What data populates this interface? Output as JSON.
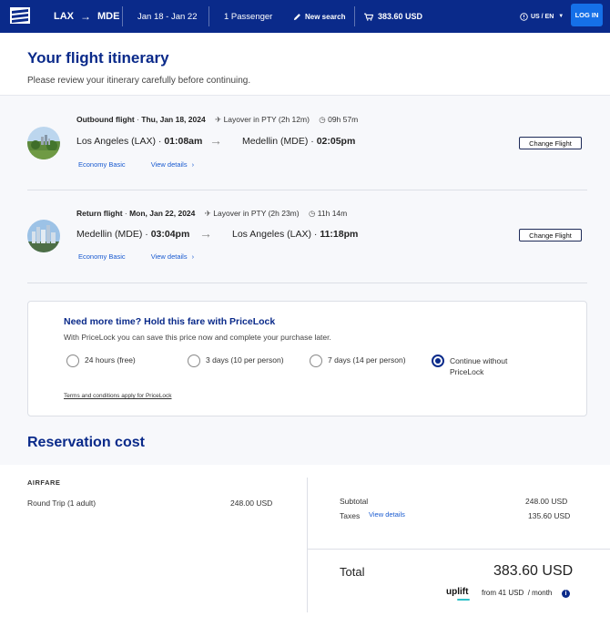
{
  "header": {
    "origin": "LAX",
    "destination": "MDE",
    "dates": "Jan 18 - Jan 22",
    "passengers": "1 Passenger",
    "new_search": "New search",
    "price": "383.60 USD",
    "language": "US / EN",
    "login": "LOG IN"
  },
  "hero": {
    "title": "Your flight itinerary",
    "subtitle": "Please review your itinerary carefully before continuing."
  },
  "outbound": {
    "label": "Outbound flight",
    "date": "Thu, Jan 18, 2024",
    "layover": "Layover in PTY (2h 12m)",
    "duration": "09h 57m",
    "from_city": "Los Angeles (LAX)",
    "from_time": "01:08am",
    "to_city": "Medellin (MDE)",
    "to_time": "02:05pm",
    "fare": "Economy Basic",
    "details": "View details",
    "change": "Change Flight"
  },
  "return": {
    "label": "Return flight",
    "date": "Mon, Jan 22, 2024",
    "layover": "Layover in PTY (2h 23m)",
    "duration": "11h 14m",
    "from_city": "Medellin (MDE)",
    "from_time": "03:04pm",
    "to_city": "Los Angeles (LAX)",
    "to_time": "11:18pm",
    "fare": "Economy Basic",
    "details": "View details",
    "change": "Change Flight"
  },
  "pricelock": {
    "title": "Need more time? Hold this fare with PriceLock",
    "subtitle": "With PriceLock you can save this price now and complete your purchase later.",
    "options": [
      {
        "label": "24 hours (free)",
        "selected": false
      },
      {
        "label": "3 days (10 per person)",
        "selected": false
      },
      {
        "label": "7 days (14 per person)",
        "selected": false
      },
      {
        "label_line1": "Continue without",
        "label_line2": "PriceLock",
        "selected": true
      }
    ],
    "terms": "Terms and conditions apply for PriceLock"
  },
  "reservation": {
    "title": "Reservation cost",
    "airfare_heading": "AIRFARE",
    "trip_label": "Round Trip (1 adult)",
    "trip_price": "248.00 USD",
    "subtotal_label": "Subtotal",
    "subtotal_value": "248.00 USD",
    "taxes_label": "Taxes",
    "taxes_link": "View details",
    "taxes_value": "135.60 USD",
    "total_label": "Total",
    "total_value": "383.60 USD",
    "uplift_brand": "uplift",
    "uplift_text": "from 41 USD",
    "uplift_period": "/ month"
  },
  "colors": {
    "brand_navy": "#0a2a8a",
    "accent_blue": "#1570e8",
    "link_blue": "#1a5bd0"
  }
}
